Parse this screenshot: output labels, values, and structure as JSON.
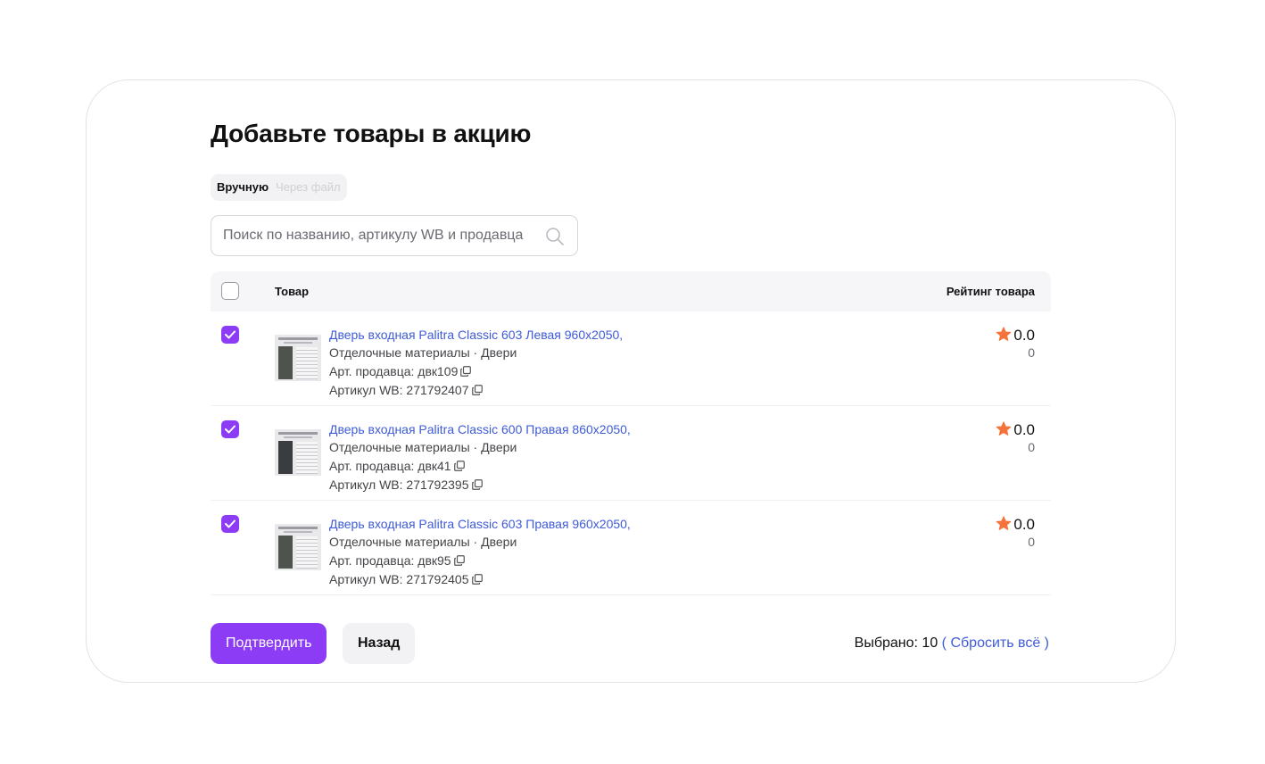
{
  "dialog": {
    "title": "Добавьте товары в акцию"
  },
  "tabs": [
    {
      "label": "Вручную",
      "active": true
    },
    {
      "label": "Через файл",
      "active": false
    }
  ],
  "search": {
    "placeholder": "Поиск по названию, артикулу WB и продавца",
    "value": ""
  },
  "table": {
    "columns": {
      "product": "Товар",
      "rating": "Рейтинг товара"
    },
    "select_all_checked": false,
    "rows": [
      {
        "checked": true,
        "name": "Дверь входная Palitra Classic 603 Левая 960х2050,",
        "category": "Отделочные материалы · Двери",
        "seller_article": "Арт. продавца: двк109",
        "wb_article": "Артикул WB: 271792407",
        "rating": "0.0",
        "reviews": "0"
      },
      {
        "checked": true,
        "name": "Дверь входная Palitra Classic 600 Правая 860х2050,",
        "category": "Отделочные материалы · Двери",
        "seller_article": "Арт. продавца: двк41",
        "wb_article": "Артикул WB: 271792395",
        "rating": "0.0",
        "reviews": "0"
      },
      {
        "checked": true,
        "name": "Дверь входная Palitra Classic 603 Правая 960х2050,",
        "category": "Отделочные материалы · Двери",
        "seller_article": "Арт. продавца: двк95",
        "wb_article": "Артикул WB: 271792405",
        "rating": "0.0",
        "reviews": "0"
      }
    ]
  },
  "footer": {
    "confirm_label": "Подтвердить",
    "back_label": "Назад",
    "selected_label": "Выбрано: 10",
    "reset_label": "( Сбросить всё )"
  },
  "colors": {
    "accent": "#8c3cf5",
    "link": "#3f5bd8",
    "star": "#f5733a"
  }
}
